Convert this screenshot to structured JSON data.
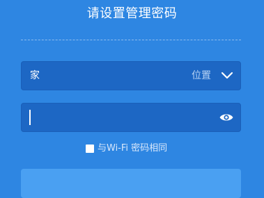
{
  "header": {
    "title": "请设置管理密码"
  },
  "location": {
    "value": "家",
    "label": "位置",
    "icon": "chevron-down-icon"
  },
  "password": {
    "value": "",
    "icon": "eye-icon"
  },
  "same_as_wifi": {
    "checked": false,
    "label": "与Wi-Fi 密码相同"
  },
  "colors": {
    "background": "#2e86e2",
    "field": "#1d67c4",
    "button": "#4aa0f2"
  }
}
